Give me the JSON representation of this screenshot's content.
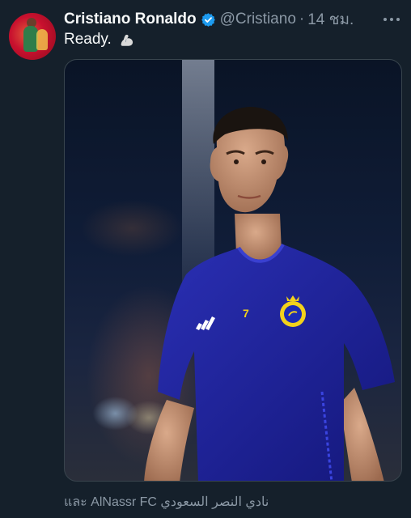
{
  "tweet": {
    "author_name": "Cristiano Ronaldo",
    "handle": "@Cristiano",
    "separator": "·",
    "timestamp": "14 ชม.",
    "text": "Ready.",
    "emoji": "flexed-biceps-icon",
    "footer_text": "และ AlNassr FC نادي النصر السعودي"
  },
  "colors": {
    "background": "#15202b",
    "verified": "#1d9bf0",
    "muted": "#8b98a5",
    "jersey": "#1c1f8c",
    "crest": "#f3d21b"
  },
  "media": {
    "jersey_number": "7"
  }
}
